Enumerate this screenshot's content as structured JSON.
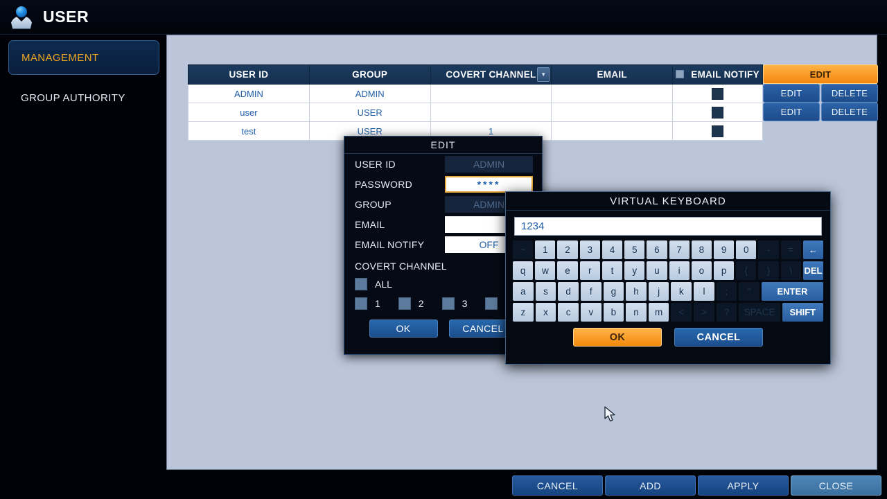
{
  "header": {
    "title": "USER",
    "icon": "user-avatar-icon"
  },
  "sidebar": {
    "items": [
      {
        "label": "MANAGEMENT",
        "active": true
      },
      {
        "label": "GROUP AUTHORITY",
        "active": false
      }
    ]
  },
  "table": {
    "columns": [
      "USER ID",
      "GROUP",
      "COVERT CHANNEL",
      "EMAIL",
      "EMAIL NOTIFY"
    ],
    "covert_dropdown_icon": "chevron-down-icon",
    "notify_header_checkbox": "unchecked",
    "rows": [
      {
        "user_id": "ADMIN",
        "group": "ADMIN",
        "covert": "",
        "email": "",
        "notify": "unchecked",
        "edit": "EDIT",
        "delete": "",
        "edit_highlight": true
      },
      {
        "user_id": "user",
        "group": "USER",
        "covert": "",
        "email": "",
        "notify": "unchecked",
        "edit": "EDIT",
        "delete": "DELETE",
        "edit_highlight": false
      },
      {
        "user_id": "test",
        "group": "USER",
        "covert": "1",
        "email": "",
        "notify": "unchecked",
        "edit": "EDIT",
        "delete": "DELETE",
        "edit_highlight": false
      }
    ]
  },
  "edit_dialog": {
    "title": "EDIT",
    "fields": {
      "user_id_label": "USER ID",
      "user_id_value": "ADMIN",
      "password_label": "PASSWORD",
      "password_value": "****",
      "group_label": "GROUP",
      "group_value": "ADMIN",
      "email_label": "EMAIL",
      "email_value": "",
      "email_notify_label": "EMAIL NOTIFY",
      "email_notify_value": "OFF"
    },
    "covert_channel_label": "COVERT CHANNEL",
    "checkboxes": [
      {
        "label": "ALL",
        "checked": false
      },
      {
        "label": "1",
        "checked": false
      },
      {
        "label": "2",
        "checked": false
      },
      {
        "label": "3",
        "checked": false
      },
      {
        "label": "",
        "checked": false
      }
    ],
    "ok_label": "OK",
    "cancel_label": "CANCEL"
  },
  "keyboard": {
    "title": "VIRTUAL KEYBOARD",
    "input_value": "1234",
    "rows": [
      [
        {
          "k": "~",
          "s": "dim"
        },
        {
          "k": "1"
        },
        {
          "k": "2"
        },
        {
          "k": "3"
        },
        {
          "k": "4"
        },
        {
          "k": "5"
        },
        {
          "k": "6"
        },
        {
          "k": "7"
        },
        {
          "k": "8"
        },
        {
          "k": "9"
        },
        {
          "k": "0"
        },
        {
          "k": "-",
          "s": "dim"
        },
        {
          "k": "=",
          "s": "dim"
        },
        {
          "k": "←",
          "s": "act",
          "n": "backspace-key"
        }
      ],
      [
        {
          "k": "q"
        },
        {
          "k": "w"
        },
        {
          "k": "e"
        },
        {
          "k": "r"
        },
        {
          "k": "t"
        },
        {
          "k": "y"
        },
        {
          "k": "u"
        },
        {
          "k": "i"
        },
        {
          "k": "o"
        },
        {
          "k": "p"
        },
        {
          "k": "{",
          "s": "dim"
        },
        {
          "k": "}",
          "s": "dim"
        },
        {
          "k": "\\",
          "s": "dim"
        },
        {
          "k": "DEL",
          "s": "act",
          "n": "del-key"
        }
      ],
      [
        {
          "k": "a"
        },
        {
          "k": "s"
        },
        {
          "k": "d"
        },
        {
          "k": "f"
        },
        {
          "k": "g"
        },
        {
          "k": "h"
        },
        {
          "k": "j"
        },
        {
          "k": "k"
        },
        {
          "k": "l"
        },
        {
          "k": ";",
          "s": "dim"
        },
        {
          "k": "\"",
          "s": "dim"
        },
        {
          "k": "ENTER",
          "s": "act",
          "w": 3,
          "n": "enter-key"
        }
      ],
      [
        {
          "k": "z"
        },
        {
          "k": "x"
        },
        {
          "k": "c"
        },
        {
          "k": "v"
        },
        {
          "k": "b"
        },
        {
          "k": "n"
        },
        {
          "k": "m"
        },
        {
          "k": "<",
          "s": "dim"
        },
        {
          "k": ">",
          "s": "dim"
        },
        {
          "k": "?",
          "s": "dim"
        },
        {
          "k": "SPACE",
          "s": "dim",
          "w": 2,
          "n": "space-key"
        },
        {
          "k": "SHIFT",
          "s": "act",
          "w": 2,
          "n": "shift-key"
        }
      ]
    ],
    "ok_label": "OK",
    "cancel_label": "CANCEL"
  },
  "bottom_bar": {
    "buttons": [
      {
        "label": "CANCEL",
        "highlight": false
      },
      {
        "label": "ADD",
        "highlight": false
      },
      {
        "label": "APPLY",
        "highlight": false
      },
      {
        "label": "CLOSE",
        "highlight": true
      }
    ]
  },
  "colors": {
    "accent_orange": "#f4870f",
    "panel_bg": "#bcc6da",
    "header_navy": "#1b3a5e",
    "link_blue": "#1f5fa8",
    "button_blue": "#27599c"
  }
}
